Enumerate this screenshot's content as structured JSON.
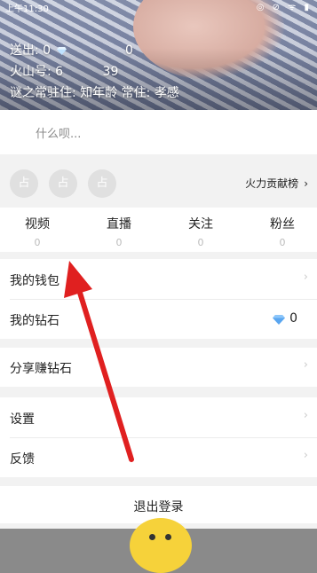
{
  "status_bar": {
    "time": "上午11:30",
    "icons": "◎ ⊘ ᯤ ▮"
  },
  "profile": {
    "sent_label": "送出: 0",
    "sent_suffix": "0",
    "id_label": "火山号: 6",
    "id_suffix": "39",
    "location_line": "谜之常驻住: 知年龄  常住: 孝感"
  },
  "signature": {
    "placeholder": "什么呗..."
  },
  "fans_row": {
    "seat_label": "占",
    "contribution_label": "火力贡献榜",
    "chevron": "›"
  },
  "stats": [
    {
      "label": "视频",
      "value": "0"
    },
    {
      "label": "直播",
      "value": "0"
    },
    {
      "label": "关注",
      "value": "0"
    },
    {
      "label": "粉丝",
      "value": "0"
    }
  ],
  "menu": {
    "wallet": "我的钱包",
    "diamonds": "我的钻石",
    "diamond_count": "0",
    "share": "分享赚钻石",
    "settings": "设置",
    "feedback": "反馈",
    "arrow": "›"
  },
  "logout": {
    "label": "退出登录"
  },
  "colors": {
    "accent_red": "#e02020",
    "diamond_blue": "#5aa6f0"
  }
}
